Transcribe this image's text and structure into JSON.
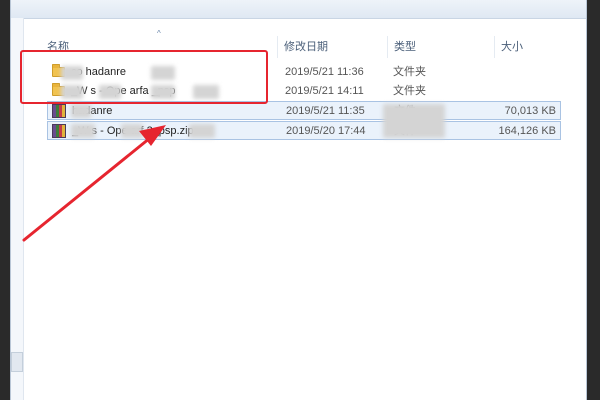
{
  "columns": {
    "name": "名称",
    "date": "修改日期",
    "type": "类型",
    "size": "大小"
  },
  "sort_indicator": "^",
  "files": [
    {
      "icon": "folder-icon",
      "name": "co    hadanre",
      "date": "2019/5/21 11:36",
      "type": "文件夹",
      "size": ""
    },
    {
      "icon": "folder-icon",
      "name": "_W    s - Ope    arfa    _psp",
      "date": "2019/5/21 14:11",
      "type": "文件夹",
      "size": ""
    },
    {
      "icon": "archive-icon",
      "name": "    hadanre",
      "date": "2019/5/21 11:35",
      "type": "文件",
      "size": "70,013 KB"
    },
    {
      "icon": "archive-icon",
      "name": "_W    s - Ope    arf    2_psp.zip",
      "date": "2019/5/20 17:44",
      "type": "文件",
      "size": "164,126 KB"
    }
  ],
  "annotation": {
    "highlight_color": "#e6252f",
    "arrow_color": "#e6252f"
  }
}
